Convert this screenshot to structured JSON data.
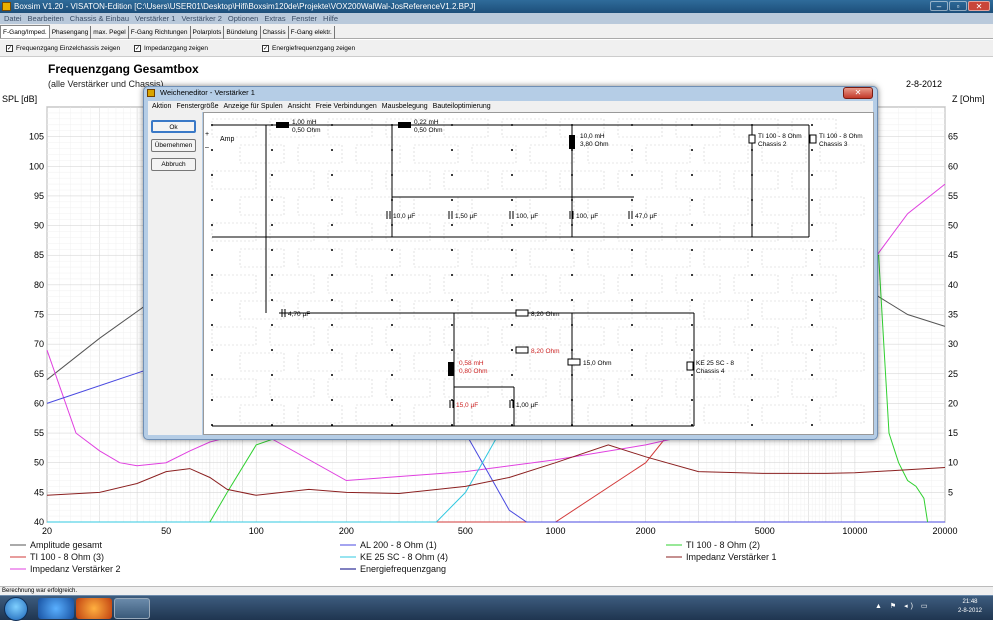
{
  "app": {
    "title": "Boxsim V1.20 - VISATON-Edition [C:\\Users\\USER01\\Desktop\\Hifi\\Boxsim120de\\Projekte\\VOX200WalWal-JosReferenceV1.2.BPJ]",
    "window_controls": [
      "–",
      "▫",
      "✕"
    ]
  },
  "menu": [
    "Datei",
    "Bearbeiten",
    "Chassis & Einbau",
    "Verstärker 1",
    "Verstärker 2",
    "Optionen",
    "Extras",
    "Fenster",
    "Hilfe"
  ],
  "tabs": [
    "F-Gang/Imped.",
    "Phasengang",
    "max. Pegel",
    "F-Gang Richtungen",
    "Polarplots",
    "Bündelung",
    "Chassis",
    "F-Gang elektr."
  ],
  "active_tab": 0,
  "checks": [
    {
      "label": "Frequenzgang Einzelchassis zeigen",
      "checked": true
    },
    {
      "label": "Impedanzgang zeigen",
      "checked": true
    },
    {
      "label": "Energiefrequenzgang zeigen",
      "checked": true
    }
  ],
  "chart": {
    "title": "Frequenzgang Gesamtbox",
    "subtitle": "(alle Verstärker und Chassis)",
    "date": "2-8-2012",
    "ylabel_left": "SPL [dB]",
    "ylabel_right": "Z [Ohm]"
  },
  "chart_data": {
    "type": "line",
    "title": "Frequenzgang Gesamtbox",
    "subtitle": "(alle Verstärker und Chassis)",
    "xscale": "log",
    "xlim": [
      20,
      20000
    ],
    "x_ticks": [
      20,
      50,
      100,
      200,
      500,
      1000,
      2000,
      5000,
      10000,
      20000
    ],
    "ylabel": "SPL [dB]",
    "ylim": [
      40,
      110
    ],
    "y_ticks": [
      40,
      45,
      50,
      55,
      60,
      65,
      70,
      75,
      80,
      85,
      90,
      95,
      100,
      105
    ],
    "y2label": "Z [Ohm]",
    "y2lim": [
      0,
      70
    ],
    "y2_ticks": [
      5,
      10,
      15,
      20,
      25,
      30,
      35,
      40,
      45,
      50,
      55,
      60,
      65
    ],
    "grid": true,
    "series": [
      {
        "name": "Amplitude gesamt",
        "color": "#555555",
        "axis": "left",
        "x": [
          20,
          30,
          50,
          70,
          100,
          200,
          500,
          1000,
          2000,
          3000,
          5000,
          6000,
          7000,
          8000,
          10000,
          12000,
          15000,
          20000
        ],
        "y": [
          64,
          71,
          79,
          80.5,
          82,
          86,
          88,
          87,
          87.5,
          88.5,
          90,
          88,
          86,
          84,
          81,
          78,
          75,
          73
        ]
      },
      {
        "name": "TI 100 - 8 Ohm (3)",
        "color": "#d23b3b",
        "axis": "left",
        "x": [
          20,
          200,
          1000,
          2000,
          5000,
          8000,
          10000
        ],
        "y": [
          40,
          40,
          40,
          50,
          75,
          90,
          95
        ]
      },
      {
        "name": "Impedanz Verstärker 2",
        "color": "#e040e0",
        "axis": "right",
        "x": [
          20,
          25,
          30,
          35,
          40,
          50,
          60,
          70,
          100,
          200,
          500,
          1000,
          2000,
          3000,
          5000,
          8000,
          10000,
          15000,
          20000
        ],
        "y": [
          29,
          15,
          12,
          10,
          9.5,
          10,
          12,
          13.5,
          15.5,
          7,
          8.5,
          10.5,
          13,
          15,
          22,
          32,
          40,
          52,
          57
        ]
      },
      {
        "name": "AL 200 - 8 Ohm (1)",
        "color": "#4848e0",
        "axis": "left",
        "x": [
          20,
          300,
          400,
          500,
          600,
          700,
          800,
          1000,
          20000
        ],
        "y": [
          60,
          80,
          82,
          55,
          48,
          42,
          40,
          40,
          40
        ]
      },
      {
        "name": "KE 25 SC - 8 Ohm    (4)",
        "color": "#30c8e0",
        "axis": "left",
        "x": [
          20,
          400,
          500,
          600,
          700,
          1000,
          2000
        ],
        "y": [
          40,
          40,
          45,
          52,
          58,
          75,
          88
        ]
      },
      {
        "name": "Energiefrequenzgang",
        "color": "#000080",
        "axis": "left",
        "x": [],
        "y": []
      },
      {
        "name": "TI 100 - 8 Ohm (2)",
        "color": "#30d030",
        "axis": "left",
        "x": [
          70,
          80,
          100,
          130,
          150,
          12000,
          13000,
          14000,
          15000,
          16000,
          17000,
          17500
        ],
        "y": [
          40,
          45,
          53,
          55,
          60,
          85,
          55,
          50,
          47,
          46,
          44,
          40
        ]
      },
      {
        "name": "Impedanz Verstärker 1",
        "color": "#8b2020",
        "axis": "right",
        "x": [
          20,
          30,
          40,
          50,
          60,
          70,
          80,
          100,
          150,
          200,
          300,
          500,
          700,
          1000,
          1500,
          2000,
          3000,
          5000,
          8000,
          10000,
          15000,
          20000
        ],
        "y": [
          4.5,
          5,
          6.5,
          8.5,
          9,
          7.5,
          5.5,
          4.5,
          5.5,
          5,
          4.8,
          6,
          7.5,
          10,
          13,
          11,
          8.5,
          8.2,
          8.2,
          8.3,
          8.8,
          9.2
        ]
      }
    ]
  },
  "dialog": {
    "title": "Weicheneditor - Verstärker 1",
    "menu": [
      "Aktion",
      "Fenstergröße",
      "Anzeige für Spulen",
      "Ansicht",
      "Freie Verbindungen",
      "Mausbelegung",
      "Bauteiloptimierung"
    ],
    "buttons": [
      "Ok",
      "Übernehmen",
      "Abbruch"
    ],
    "amp_label": "Amp",
    "components": [
      {
        "name": "L1",
        "label": "1,00 mH\n0,50 Ohm",
        "kind": "coil",
        "color": "#000"
      },
      {
        "name": "L2",
        "label": "0,22 mH\n0,50 Ohm",
        "kind": "coil",
        "color": "#000"
      },
      {
        "name": "L3",
        "label": "10,0 mH\n3,80 Ohm",
        "kind": "coil",
        "color": "#000"
      },
      {
        "name": "C1",
        "label": "10,0 µF",
        "kind": "cap",
        "color": "#000"
      },
      {
        "name": "C2",
        "label": "1,50 µF",
        "kind": "cap",
        "color": "#000"
      },
      {
        "name": "C3",
        "label": "100, µF",
        "kind": "cap",
        "color": "#000"
      },
      {
        "name": "C4",
        "label": "100, µF",
        "kind": "cap",
        "color": "#000"
      },
      {
        "name": "C5",
        "label": "47,0 µF",
        "kind": "cap",
        "color": "#000"
      },
      {
        "name": "D1",
        "label": "TI 100 - 8 Ohm\nChassis 2",
        "kind": "driver",
        "color": "#000"
      },
      {
        "name": "D2",
        "label": "TI 100 - 8 Ohm\nChassis 3",
        "kind": "driver",
        "color": "#000"
      },
      {
        "name": "C6",
        "label": "4,70 µF",
        "kind": "cap",
        "color": "#000"
      },
      {
        "name": "R1",
        "label": "8,20 Ohm",
        "kind": "res",
        "color": "#000"
      },
      {
        "name": "R2",
        "label": "8,20 Ohm",
        "kind": "res",
        "color": "#cc2020"
      },
      {
        "name": "R3",
        "label": "15,0 Ohm",
        "kind": "res",
        "color": "#000"
      },
      {
        "name": "L4",
        "label": "0,58 mH\n0,80 Ohm",
        "kind": "coil",
        "color": "#cc2020"
      },
      {
        "name": "C7",
        "label": "15,0 µF",
        "kind": "cap",
        "color": "#cc2020"
      },
      {
        "name": "C8",
        "label": "1,00 µF",
        "kind": "cap",
        "color": "#000"
      },
      {
        "name": "D3",
        "label": "KE 25 SC - 8\nChassis 4",
        "kind": "driver",
        "color": "#000"
      }
    ]
  },
  "statusbar": "Berechnung war erfolgreich.",
  "taskbar": {
    "time": "21:48",
    "date": "2-8-2012",
    "tray": "▲ ⚑ ◂) ▭"
  }
}
